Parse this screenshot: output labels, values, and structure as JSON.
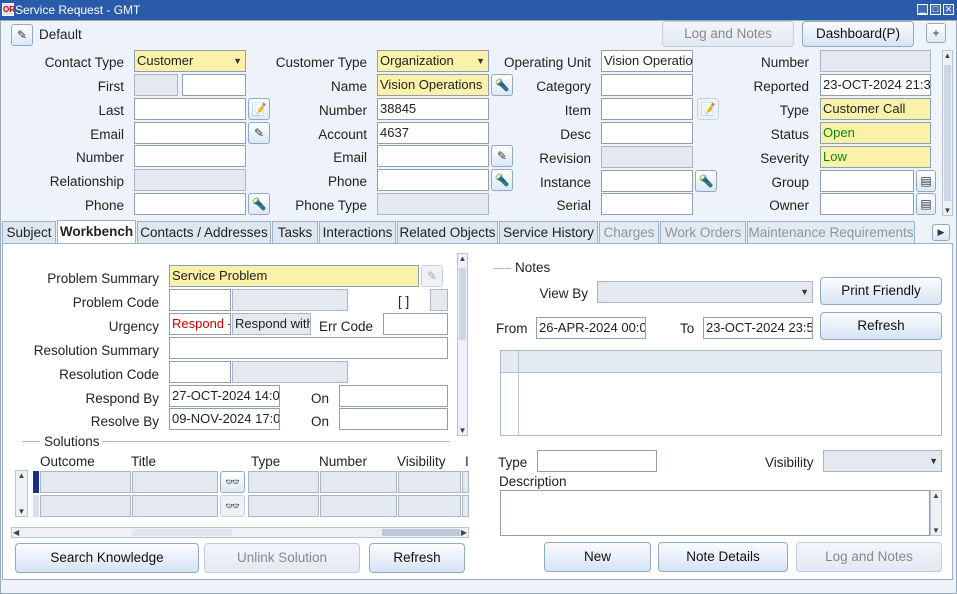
{
  "window": {
    "title": "Service Request - GMT",
    "logo": "OR",
    "minimize": "▁",
    "maximize": "□",
    "close": "✕"
  },
  "toolbar": {
    "default_label": "Default",
    "log_notes": "Log and Notes",
    "dashboard": "Dashboard(P)",
    "expand": "+"
  },
  "contact": {
    "type_label": "Contact Type",
    "type_value": "Customer",
    "first_label": "First",
    "last_label": "Last",
    "email_label": "Email",
    "number_label": "Number",
    "relationship_label": "Relationship",
    "phone_label": "Phone"
  },
  "customer": {
    "type_label": "Customer Type",
    "type_value": "Organization",
    "name_label": "Name",
    "name_value": "Vision Operations",
    "number_label": "Number",
    "number_value": "38845",
    "account_label": "Account",
    "account_value": "4637",
    "email_label": "Email",
    "phone_label": "Phone",
    "phone_type_label": "Phone Type"
  },
  "product": {
    "ou_label": "Operating Unit",
    "ou_value": "Vision Operatio",
    "category_label": "Category",
    "item_label": "Item",
    "desc_label": "Desc",
    "revision_label": "Revision",
    "instance_label": "Instance",
    "serial_label": "Serial"
  },
  "request": {
    "number_label": "Number",
    "reported_label": "Reported",
    "reported_value": "23-OCT-2024 21:3",
    "type_label": "Type",
    "type_value": "Customer Call",
    "status_label": "Status",
    "status_value": "Open",
    "severity_label": "Severity",
    "severity_value": "Low",
    "group_label": "Group",
    "owner_label": "Owner"
  },
  "tabs": [
    "Subject",
    "Workbench",
    "Contacts / Addresses",
    "Tasks",
    "Interactions",
    "Related Objects",
    "Service History",
    "Charges",
    "Work Orders",
    "Maintenance Requirements"
  ],
  "workbench": {
    "problem_summary_label": "Problem Summary",
    "problem_summary_value": "Service Problem",
    "problem_code_label": "Problem Code",
    "brackets": "[ ]",
    "urgency_label": "Urgency",
    "urgency_value": "Respond -",
    "urgency_desc": "Respond with",
    "err_code_label": "Err Code",
    "resolution_summary_label": "Resolution Summary",
    "resolution_code_label": "Resolution Code",
    "respond_by_label": "Respond By",
    "respond_by_value": "27-OCT-2024 14:0",
    "resolve_by_label": "Resolve By",
    "resolve_by_value": "09-NOV-2024 17:0",
    "on_label": "On"
  },
  "solutions": {
    "title": "Solutions",
    "columns": [
      "Outcome",
      "Title",
      "Type",
      "Number",
      "Visibility",
      "I"
    ],
    "search_knowledge": "Search Knowledge",
    "unlink": "Unlink Solution",
    "refresh": "Refresh"
  },
  "notes": {
    "title": "Notes",
    "view_by_label": "View By",
    "print_friendly": "Print Friendly",
    "from_label": "From",
    "from_value": "26-APR-2024 00:0",
    "to_label": "To",
    "to_value": "23-OCT-2024 23:5",
    "refresh": "Refresh",
    "type_label": "Type",
    "visibility_label": "Visibility",
    "description_label": "Description",
    "new": "New",
    "note_details": "Note Details",
    "log_notes": "Log and Notes"
  },
  "icons": {
    "default_icon": "✎",
    "flashlight": "🔦",
    "glasses": "👓",
    "note": "📝",
    "pencil": "✎",
    "lov": "▤"
  }
}
